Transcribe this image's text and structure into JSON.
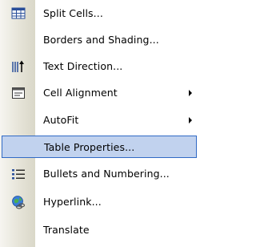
{
  "menu": {
    "items": [
      {
        "label": "Split Cells...",
        "icon": "split-cells-icon",
        "submenu": false
      },
      {
        "label": "Borders and Shading...",
        "icon": "",
        "submenu": false
      },
      {
        "label": "Text Direction...",
        "icon": "text-direction-icon",
        "submenu": false
      },
      {
        "label": "Cell Alignment",
        "icon": "cell-alignment-icon",
        "submenu": true
      },
      {
        "label": "AutoFit",
        "icon": "",
        "submenu": true
      },
      {
        "label": "Table Properties...",
        "icon": "",
        "submenu": false,
        "highlighted": true
      },
      {
        "label": "Bullets and Numbering...",
        "icon": "bullets-numbering-icon",
        "submenu": false
      },
      {
        "label": "Hyperlink...",
        "icon": "hyperlink-icon",
        "submenu": false
      },
      {
        "label": "Translate",
        "icon": "",
        "submenu": false
      }
    ]
  },
  "colors": {
    "highlight_fill": "#c1d2ee",
    "highlight_border": "#316ac5",
    "gutter": "#e6e4d8"
  }
}
